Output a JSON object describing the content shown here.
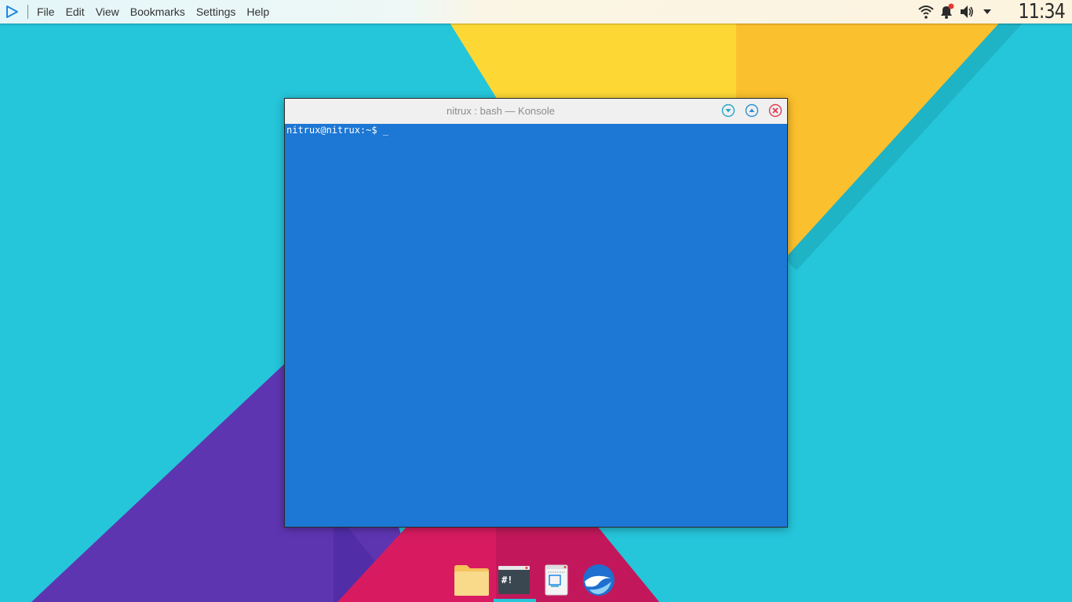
{
  "panel": {
    "launcher_icon": "play-triangle-icon",
    "menu": [
      "File",
      "Edit",
      "View",
      "Bookmarks",
      "Settings",
      "Help"
    ],
    "tray_icons": [
      "wifi-icon",
      "notification-bell-icon",
      "volume-icon",
      "expand-tray-icon"
    ],
    "clock": "11:34"
  },
  "window": {
    "title": "nitrux : bash — Konsole",
    "buttons": [
      "minimize-icon",
      "maximize-icon",
      "close-icon"
    ],
    "terminal": {
      "prompt": "nitrux@nitrux:~$ ",
      "cursor": "_"
    }
  },
  "dock": {
    "items": [
      "file-manager-icon",
      "terminal-icon",
      "screenshot-tool-icon",
      "browser-icon"
    ],
    "active_index": 1
  },
  "colors": {
    "desktop_bg": "#25c5da",
    "terminal_bg": "#1c77d5",
    "yellow": "#fdd835",
    "orange": "#fbc02d",
    "purple": "#5e35b1",
    "pink": "#d81b60",
    "accent": "#25c5da"
  }
}
